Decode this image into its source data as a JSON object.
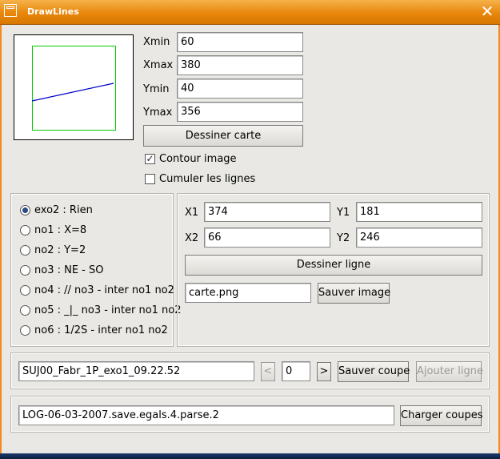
{
  "window": {
    "title": "DrawLines",
    "close_glyph": "✕"
  },
  "bounds": {
    "xmin_label": "Xmin",
    "xmin_value": "60",
    "xmax_label": "Xmax",
    "xmax_value": "380",
    "ymin_label": "Ymin",
    "ymin_value": "40",
    "ymax_label": "Ymax",
    "ymax_value": "356",
    "draw_map_button": "Dessiner carte"
  },
  "options": {
    "contour_label": "Contour image",
    "contour_checked": true,
    "cumulate_label": "Cumuler les lignes",
    "cumulate_checked": false
  },
  "exercises": {
    "selected_index": 0,
    "items": [
      "exo2 : Rien",
      "no1 : X=8",
      "no2 : Y=2",
      "no3 : NE - SO",
      "no4 : // no3 - inter no1 no2",
      "no5 : _|_ no3 - inter no1 no2",
      "no6 : 1/2S - inter no1 no2"
    ]
  },
  "line": {
    "x1_label": "X1",
    "x1_value": "374",
    "y1_label": "Y1",
    "y1_value": "181",
    "x2_label": "X2",
    "x2_value": "66",
    "y2_label": "Y2",
    "y2_value": "246",
    "draw_line_button": "Dessiner ligne",
    "image_filename": "carte.png",
    "save_image_button": "Sauver image"
  },
  "cut": {
    "name_value": "SUJ00_Fabr_1P_exo1_09.22.52",
    "prev_label": "<",
    "index_value": "0",
    "next_label": ">",
    "save_cut_button": "Sauver coupe",
    "add_line_button": "Ajouter ligne"
  },
  "log": {
    "file_value": "LOG-06-03-2007.save.egals.4.parse.2",
    "load_cuts_button": "Charger coupes"
  },
  "colors": {
    "title_bar": "#e8870c",
    "preview_rect": "#00cc00",
    "preview_line": "#0000cc"
  }
}
